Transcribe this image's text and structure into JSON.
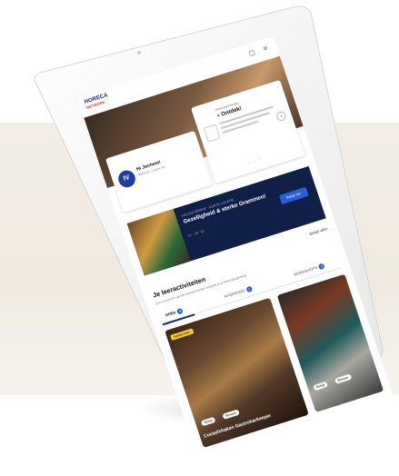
{
  "header": {
    "logo_line1": "HORECA",
    "logo_line2": "NETWORK",
    "icons": [
      "calendar-icon",
      "menu-icon"
    ]
  },
  "welcome": {
    "avatar_initials": "IV",
    "greeting": "Hi Jochem!",
    "subtitle": "Welkom, 2 jaren lid"
  },
  "news": {
    "kicker": "Werkzaamheden",
    "title": "Ontdek!",
    "dots": "• — •"
  },
  "promo": {
    "kicker": "VEILIGE KENNIS · KORTE LOCATIE",
    "title": "Gezelligheid & sterke Grammen!",
    "meta": "21 · 28 · 33",
    "button": "Bekijk hier"
  },
  "activities": {
    "link_all": "Bekijk alles",
    "title": "Je leeractiviteiten",
    "subtitle": "Een overzicht van de leeractiviteiten waarbij je je hebt aangemeld",
    "tabs": [
      {
        "label": "OPEN",
        "count": "4"
      },
      {
        "label": "AFGEROND",
        "count": "2"
      },
      {
        "label": "WORKSHOPS",
        "count": "3"
      }
    ],
    "photo1": {
      "badge": "Aanbevolen",
      "chip1": "Bekijk",
      "chip2": "Bewaar",
      "caption": "Coctailshaken Gastrobarkeeper"
    },
    "photo2": {
      "chip1": "Bekijk",
      "chip2": "Bewaar"
    }
  },
  "colors": {
    "navy": "#0f1f46",
    "accent_blue": "#2a5ed8",
    "badge_yellow": "#f5c832",
    "beige": "#f1ece4"
  }
}
